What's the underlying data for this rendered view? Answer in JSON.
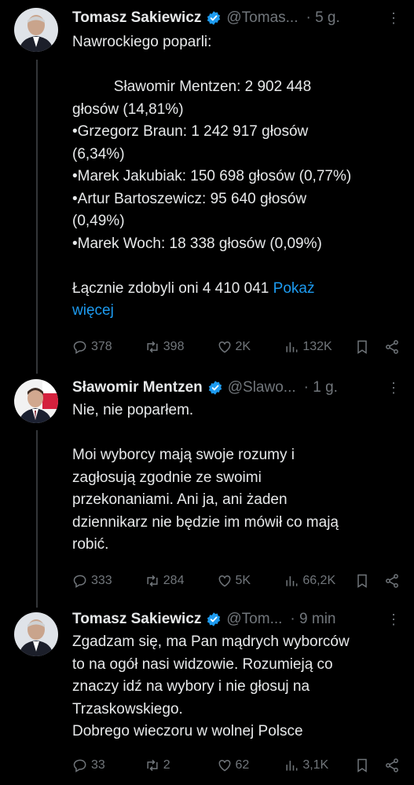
{
  "tweets": [
    {
      "name": "Tomasz Sakiewicz",
      "handle": "@Tomas...",
      "time": "· 5 g.",
      "paragraphs": [
        "Nawrockiego poparli:",
        "",
        "          Sławomir Mentzen: 2 902 448\ngłosów (14,81%)\n•Grzegorz Braun: 1 242 917 głosów\n(6,34%)\n•Marek Jakubiak: 150 698 głosów (0,77%)\n•Artur Bartoszewicz: 95 640 głosów\n(0,49%)\n•Marek Woch: 18 338 głosów (0,09%)",
        "",
        "Łącznie zdobyli oni 4 410 041 "
      ],
      "show_more": "Pokaż\nwięcej",
      "replies": "378",
      "retweets": "398",
      "likes": "2K",
      "views": "132K"
    },
    {
      "name": "Sławomir Mentzen",
      "handle": "@Slawo...",
      "time": "· 1 g.",
      "paragraphs": [
        "Nie, nie poparłem.",
        "",
        "Moi wyborcy mają swoje rozumy i\nzagłosują zgodnie ze swoimi\nprzekonaniami. Ani ja, ani żaden\ndziennikarz nie będzie im mówił co mają\nrobić."
      ],
      "replies": "333",
      "retweets": "284",
      "likes": "5K",
      "views": "66,2K"
    },
    {
      "name": "Tomasz Sakiewicz",
      "handle": "@Tom...",
      "time": "· 9 min",
      "paragraphs": [
        "Zgadzam się, ma Pan mądrych wyborców\nto na ogół nasi widzowie. Rozumieją co\nznaczy idź na wybory i nie głosuj na\nTrzaskowskiego.\nDobrego wieczoru w wolnej Polsce"
      ],
      "replies": "33",
      "retweets": "2",
      "likes": "62",
      "views": "3,1K"
    }
  ],
  "colors": {
    "background": "#000000",
    "text": "#e7e9ea",
    "muted": "#71767b",
    "link": "#1d9bf0",
    "verified": "#1d9bf0",
    "thread_line": "#333639"
  }
}
